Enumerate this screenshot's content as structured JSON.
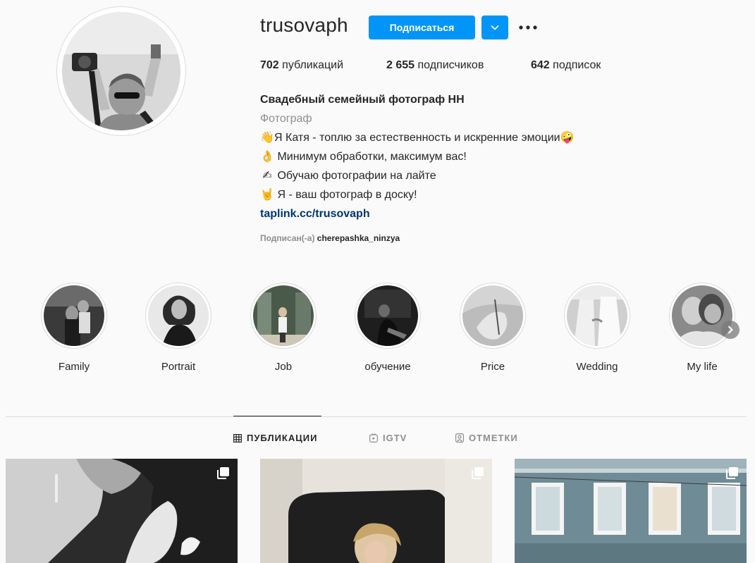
{
  "profile": {
    "username": "trusovaph",
    "follow_label": "Подписаться",
    "stats": [
      {
        "count": "702",
        "label": " публикаций"
      },
      {
        "count": "2 655",
        "label": " подписчиков"
      },
      {
        "count": "642",
        "label": " подписок"
      }
    ],
    "full_name": "Свадебный семейный фотограф НН",
    "category": "Фотограф",
    "bio_lines": [
      {
        "emoji": "👋",
        "text": "Я Катя - топлю за естественность и искренние эмоции",
        "trail": "🤪"
      },
      {
        "emoji": "👌",
        "text": " Минимум обработки, максимум вас!"
      },
      {
        "emoji": "✍",
        "text": " Обучаю фотографии на лайте"
      },
      {
        "emoji": "🤘",
        "text": " Я - ваш фотограф в доску!"
      }
    ],
    "link": "taplink.cc/trusovaph",
    "followed_by_prefix": "Подписан(-а)",
    "followed_by_name": "cherepashka_ninzya"
  },
  "highlights": [
    {
      "label": "Family"
    },
    {
      "label": "Portrait"
    },
    {
      "label": "Job"
    },
    {
      "label": "обучение"
    },
    {
      "label": "Price"
    },
    {
      "label": "Wedding"
    },
    {
      "label": "My life"
    }
  ],
  "tabs": [
    {
      "label": "ПУБЛИКАЦИИ",
      "icon": "grid-icon",
      "active": true
    },
    {
      "label": "IGTV",
      "icon": "igtv-icon",
      "active": false
    },
    {
      "label": "ОТМЕТКИ",
      "icon": "tagged-icon",
      "active": false
    }
  ],
  "posts": [
    {
      "type": "carousel",
      "icon": "multiple-photos-icon"
    },
    {
      "type": "carousel",
      "icon": "multiple-photos-icon"
    },
    {
      "type": "carousel",
      "icon": "multiple-photos-icon"
    }
  ],
  "colors": {
    "accent": "#0095f6",
    "link": "#00376b",
    "muted": "#8e8e8e",
    "text": "#262626",
    "background": "#fafafa"
  }
}
